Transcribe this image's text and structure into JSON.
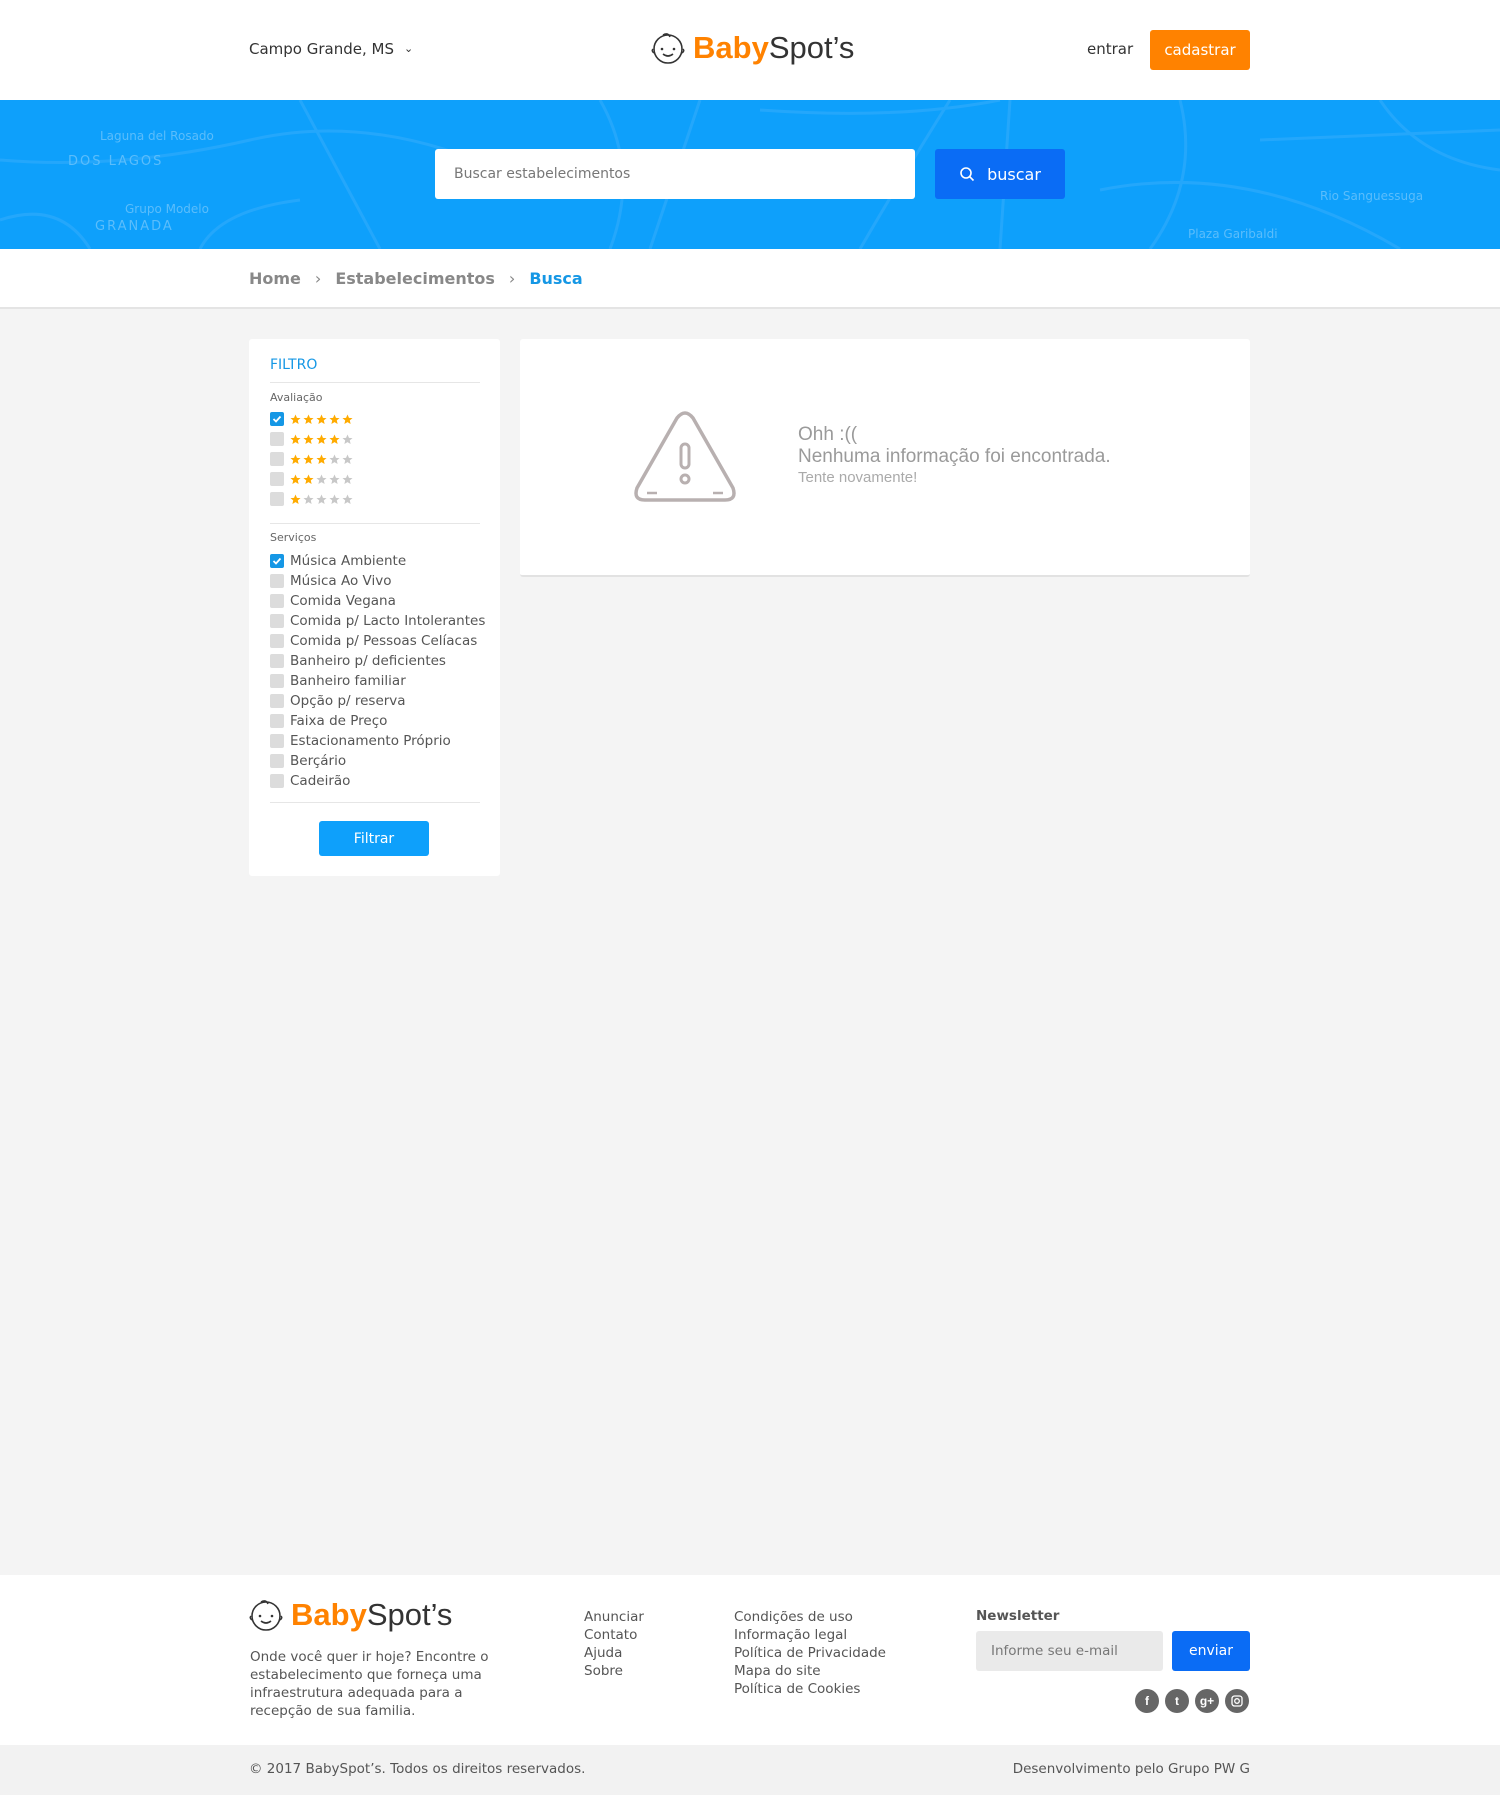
{
  "header": {
    "city": "Campo Grande, MS",
    "logo_part1": "Baby",
    "logo_part2": "Spot’s",
    "login_label": "entrar",
    "signup_label": "cadastrar"
  },
  "hero": {
    "search_placeholder": "Buscar estabelecimentos",
    "search_button": "buscar",
    "map_labels": [
      "DOS LAGOS",
      "GRANADA",
      "Grupo Modelo",
      "Rio Sanguessuga",
      "Laguna del Rosado",
      "Plaza Garibaldi"
    ]
  },
  "breadcrumb": {
    "items": [
      "Home",
      "Estabelecimentos",
      "Busca"
    ]
  },
  "filter": {
    "title": "FILTRO",
    "rating_label": "Avaliação",
    "ratings": [
      {
        "stars": 5,
        "checked": true
      },
      {
        "stars": 4,
        "checked": false
      },
      {
        "stars": 3,
        "checked": false
      },
      {
        "stars": 2,
        "checked": false
      },
      {
        "stars": 1,
        "checked": false
      }
    ],
    "services_label": "Serviços",
    "services": [
      {
        "label": "Música Ambiente",
        "checked": true
      },
      {
        "label": "Música Ao Vivo",
        "checked": false
      },
      {
        "label": "Comida Vegana",
        "checked": false
      },
      {
        "label": "Comida p/ Lacto Intolerantes",
        "checked": false
      },
      {
        "label": "Comida p/ Pessoas Celíacas",
        "checked": false
      },
      {
        "label": "Banheiro p/ deficientes",
        "checked": false
      },
      {
        "label": "Banheiro familiar",
        "checked": false
      },
      {
        "label": "Opção p/ reserva",
        "checked": false
      },
      {
        "label": "Faixa de Preço",
        "checked": false
      },
      {
        "label": "Estacionamento Próprio",
        "checked": false
      },
      {
        "label": "Berçário",
        "checked": false
      },
      {
        "label": "Cadeirão",
        "checked": false
      }
    ],
    "button": "Filtrar"
  },
  "results": {
    "line1": "Ohh :((",
    "line2": "Nenhuma informação foi encontrada.",
    "line3": "Tente novamente!"
  },
  "footer": {
    "logo_part1": "Baby",
    "logo_part2": "Spot’s",
    "tagline": "Onde você quer ir hoje? Encontre o estabelecimento que forneça uma infraestrutura adequada para a recepção de sua familia.",
    "links_col1": [
      "Anunciar",
      "Contato",
      "Ajuda",
      "Sobre"
    ],
    "links_col2": [
      "Condições de uso",
      "Informação legal",
      "Política de Privacidade",
      "Mapa do site",
      "Política de Cookies"
    ],
    "newsletter_title": "Newsletter",
    "newsletter_placeholder": "Informe seu e-mail",
    "newsletter_button": "enviar",
    "socials": [
      "facebook-icon",
      "twitter-icon",
      "google-plus-icon",
      "instagram-icon"
    ],
    "copyright": "© 2017 BabySpot’s. Todos os direitos reservados.",
    "developer": "Desenvolvimento pelo Grupo  PW  G"
  },
  "colors": {
    "brand_orange": "#ff8200",
    "hero_blue": "#0ea0fb",
    "button_blue": "#0a6cf5",
    "link_blue": "#1597e5",
    "star_gold": "#ffab00"
  }
}
